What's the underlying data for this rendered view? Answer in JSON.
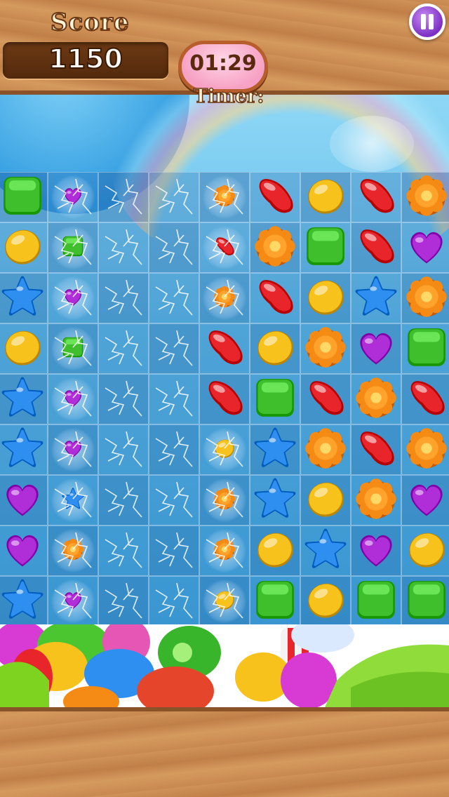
{
  "hud": {
    "score_label": "Score",
    "score_value": "1150",
    "timer_value": "01:29",
    "timer_label": "Timer:"
  },
  "icons": {
    "pause": "pause-icon"
  },
  "board": {
    "rows": 9,
    "cols": 9,
    "cleared_column": "lightning-effect",
    "grid": [
      [
        "green-square",
        "purple-heart-small",
        "empty",
        "empty",
        "orange-flower-small",
        "red-bean",
        "yellow-drop",
        "red-bean",
        "orange-flower"
      ],
      [
        "yellow-drop",
        "green-square-small",
        "empty",
        "empty",
        "red-bean-small",
        "orange-flower",
        "green-square",
        "red-bean",
        "purple-heart"
      ],
      [
        "blue-star",
        "purple-heart-small",
        "empty",
        "empty",
        "orange-flower-small",
        "red-bean",
        "yellow-drop",
        "blue-star",
        "orange-flower"
      ],
      [
        "yellow-drop",
        "green-square-small",
        "empty",
        "empty",
        "red-bean",
        "yellow-drop",
        "orange-flower",
        "purple-heart",
        "green-square"
      ],
      [
        "blue-star",
        "purple-heart-small",
        "empty",
        "empty",
        "red-bean",
        "green-square",
        "red-bean",
        "orange-flower",
        "red-bean"
      ],
      [
        "blue-star",
        "purple-heart-small",
        "empty",
        "empty",
        "yellow-drop-small",
        "blue-star",
        "orange-flower",
        "red-bean",
        "orange-flower"
      ],
      [
        "purple-heart",
        "blue-star-small",
        "empty",
        "empty",
        "orange-flower-small",
        "blue-star",
        "yellow-drop",
        "orange-flower",
        "purple-heart"
      ],
      [
        "purple-heart",
        "orange-flower-small",
        "empty",
        "empty",
        "orange-flower-small",
        "yellow-drop",
        "blue-star",
        "purple-heart",
        "yellow-drop"
      ],
      [
        "blue-star",
        "purple-heart-small",
        "empty",
        "empty",
        "yellow-drop-small",
        "green-square",
        "yellow-drop",
        "green-square",
        "green-square"
      ]
    ]
  },
  "colors": {
    "wood": "#c8884f",
    "wood_dark": "#6d3a14",
    "timer_pink": "#f7a2c4",
    "pause_purple": "#7b2fc4",
    "red": "#e8252a",
    "yellow": "#f7c21b",
    "green": "#3fbf2c",
    "blue": "#2f8ff0",
    "orange": "#f58a14",
    "purple": "#b02ed8"
  }
}
